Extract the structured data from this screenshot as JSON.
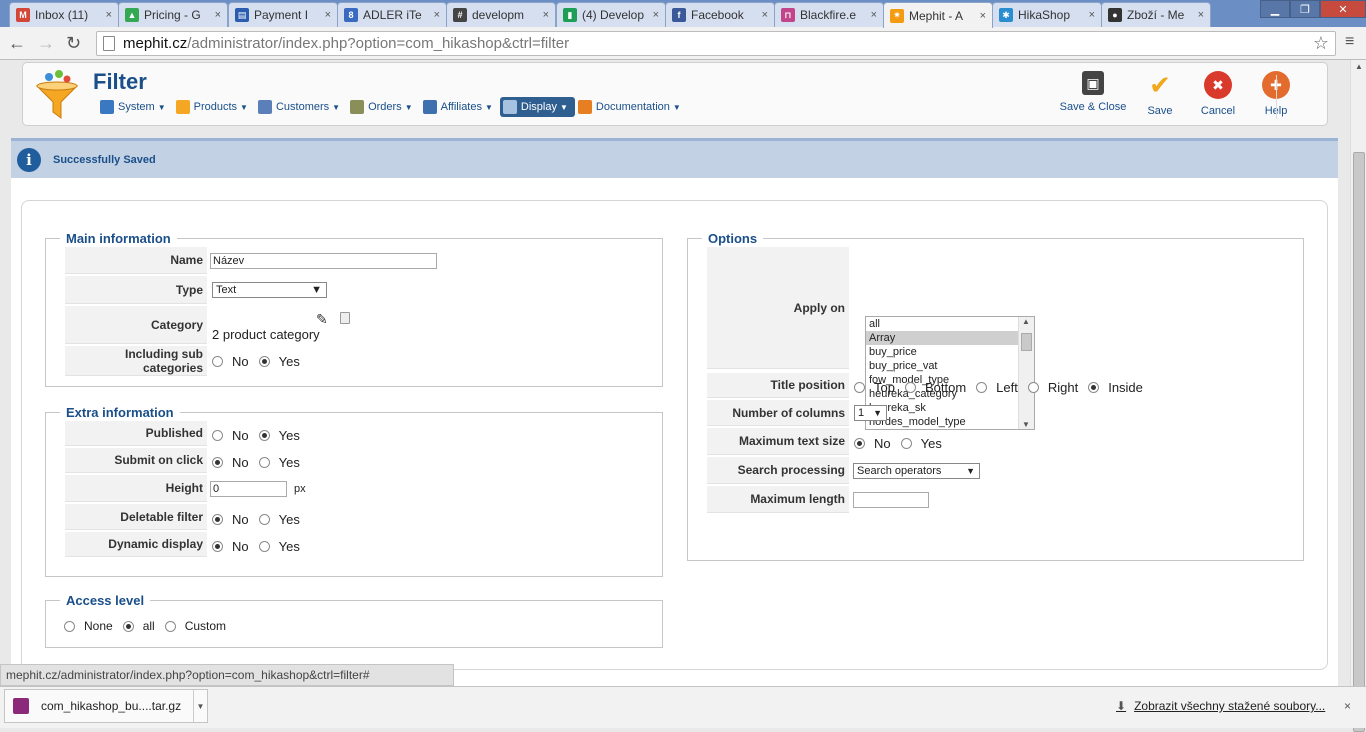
{
  "browser": {
    "tabs": [
      {
        "label": "Inbox (11)",
        "color": "#d44638",
        "glyph": "M"
      },
      {
        "label": "Pricing - G",
        "color": "#34a853",
        "glyph": "▲"
      },
      {
        "label": "Payment I",
        "color": "#2a5db0",
        "glyph": "▤"
      },
      {
        "label": "ADLER iTe",
        "color": "#3b6bc0",
        "glyph": "8"
      },
      {
        "label": "developm",
        "color": "#444444",
        "glyph": "#"
      },
      {
        "label": "(4) Develop",
        "color": "#1e9e57",
        "glyph": "▮"
      },
      {
        "label": "Facebook",
        "color": "#3b5998",
        "glyph": "f"
      },
      {
        "label": "Blackfire.e",
        "color": "#c2448a",
        "glyph": "⊓"
      },
      {
        "label": "Mephit - A",
        "color": "#f39c12",
        "glyph": "✷"
      },
      {
        "label": "HikaShop",
        "color": "#2a8dd0",
        "glyph": "✱"
      },
      {
        "label": "Zboží - Me",
        "color": "#333333",
        "glyph": "●"
      }
    ],
    "url_host": "mephit.cz",
    "url_path": "/administrator/index.php?option=com_hikashop&ctrl=filter",
    "status_url": "mephit.cz/administrator/index.php?option=com_hikashop&ctrl=filter#",
    "download_file": "com_hikashop_bu....tar.gz",
    "download_all": "Zobrazit všechny stažené soubory...",
    "download_close": "×"
  },
  "header": {
    "title": "Filter",
    "menu": [
      {
        "label": "System",
        "color": "#3a78c2"
      },
      {
        "label": "Products",
        "color": "#f5a623"
      },
      {
        "label": "Customers",
        "color": "#5b7fb8"
      },
      {
        "label": "Orders",
        "color": "#8a8f5a"
      },
      {
        "label": "Affiliates",
        "color": "#3f6fae"
      },
      {
        "label": "Display",
        "color": "#a7c1e0"
      },
      {
        "label": "Documentation",
        "color": "#e67e22"
      }
    ],
    "actions": [
      {
        "label": "Save & Close",
        "color": "#444444"
      },
      {
        "label": "Save",
        "color": "#f0a81c"
      },
      {
        "label": "Cancel",
        "color": "#d93a2b"
      },
      {
        "label": "Help",
        "color": "#e36b2e"
      }
    ]
  },
  "message": "Successfully Saved",
  "main_info": {
    "legend": "Main information",
    "name_label": "Name",
    "name_value": "Název",
    "type_label": "Type",
    "type_value": "Text",
    "category_label": "Category",
    "category_value": "2 product category",
    "subcat_label": "Including sub categories",
    "no": "No",
    "yes": "Yes"
  },
  "extra_info": {
    "legend": "Extra information",
    "published_label": "Published",
    "submit_label": "Submit on click",
    "height_label": "Height",
    "height_value": "0",
    "height_unit": "px",
    "deletable_label": "Deletable filter",
    "dynamic_label": "Dynamic display",
    "no": "No",
    "yes": "Yes"
  },
  "access": {
    "legend": "Access level",
    "none": "None",
    "all": "all",
    "custom": "Custom"
  },
  "options": {
    "legend": "Options",
    "apply_label": "Apply on",
    "apply_items": [
      "all",
      "Array",
      "buy_price",
      "buy_price_vat",
      "fow_model_type",
      "heureka_category",
      "heureka_sk",
      "hordes_model_type"
    ],
    "title_pos_label": "Title position",
    "title_pos": [
      "Top",
      "Bottom",
      "Left",
      "Right",
      "Inside"
    ],
    "columns_label": "Number of columns",
    "columns_value": "1",
    "max_text_label": "Maximum text size",
    "no": "No",
    "yes": "Yes",
    "search_label": "Search processing",
    "search_value": "Search operators",
    "max_len_label": "Maximum length"
  }
}
